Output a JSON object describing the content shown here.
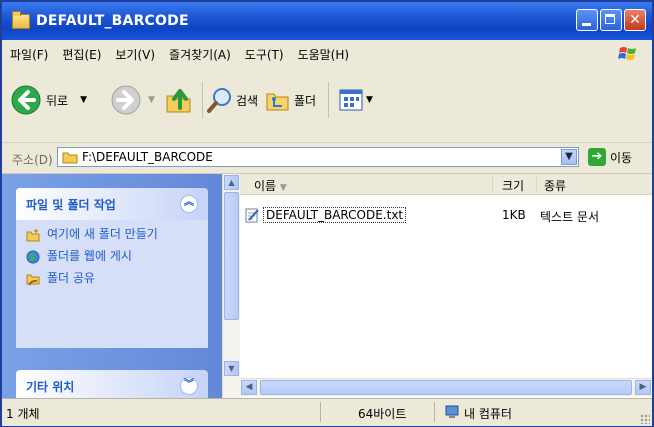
{
  "window": {
    "title": "DEFAULT_BARCODE"
  },
  "menu": [
    {
      "id": "file",
      "label": "파일(F)"
    },
    {
      "id": "edit",
      "label": "편집(E)"
    },
    {
      "id": "view",
      "label": "보기(V)"
    },
    {
      "id": "favorites",
      "label": "즐겨찾기(A)"
    },
    {
      "id": "tools",
      "label": "도구(T)"
    },
    {
      "id": "help",
      "label": "도움말(H)"
    }
  ],
  "toolbar": {
    "back": "뒤로",
    "search": "검색",
    "folders": "폴더"
  },
  "address": {
    "label": "주소(D)",
    "path": "F:\\DEFAULT_BARCODE",
    "go": "이동"
  },
  "tasks": {
    "title": "파일 및 폴더 작업",
    "items": [
      "여기에 새 폴더 만들기",
      "폴더를 웹에 게시",
      "폴더 공유"
    ]
  },
  "other_places": {
    "title": "기타 위치"
  },
  "columns": {
    "name": "이름",
    "size": "크기",
    "type": "종류"
  },
  "files": [
    {
      "name": "DEFAULT_BARCODE.txt",
      "size": "1KB",
      "type": "텍스트 문서"
    }
  ],
  "status": {
    "count": "1 개체",
    "bytes": "64바이트",
    "location": "내 컴퓨터"
  },
  "colors": {
    "title_bar": "#1f5ad6",
    "task_pane": "#6488d8",
    "task_link": "#215dc6"
  },
  "icons": [
    "folder-icon",
    "back-arrow-icon",
    "forward-arrow-icon",
    "up-folder-icon",
    "search-icon",
    "folders-icon",
    "views-icon",
    "go-arrow-icon",
    "new-folder-icon",
    "publish-web-icon",
    "share-folder-icon",
    "text-file-icon",
    "my-computer-icon"
  ]
}
